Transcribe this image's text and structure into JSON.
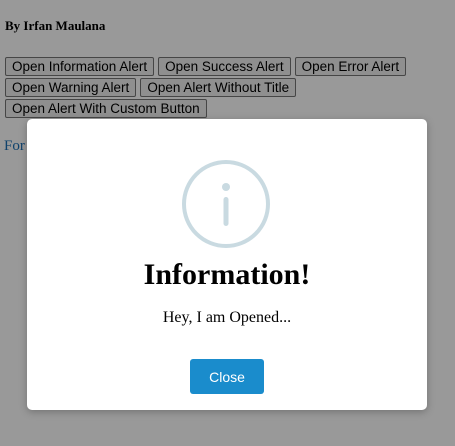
{
  "header": {
    "author": "By Irfan Maulana"
  },
  "buttons": {
    "info": "Open Information Alert",
    "success": "Open Success Alert",
    "error": "Open Error Alert",
    "warning": "Open Warning Alert",
    "no_title": "Open Alert Without Title",
    "custom": "Open Alert With Custom Button"
  },
  "footer": {
    "link_text": "For"
  },
  "modal": {
    "icon": "info-circle-icon",
    "icon_color": "#c9dae1",
    "title": "Information!",
    "text": "Hey, I am Opened...",
    "close_label": "Close",
    "close_color": "#1a8ccc"
  }
}
